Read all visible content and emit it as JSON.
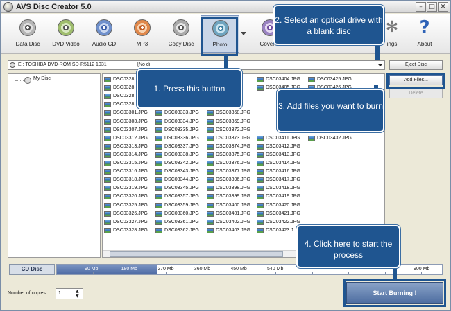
{
  "window": {
    "title": "AVS Disc Creator 5.0"
  },
  "toolbar": {
    "data_disc": "Data Disc",
    "dvd_video": "DVD Video",
    "audio_cd": "Audio CD",
    "mp3": "MP3",
    "copy_disc": "Copy Disc",
    "photo": "Photo",
    "cover": "Cover E",
    "settings": "ings",
    "about": "About"
  },
  "drive": {
    "value": "E : TOSHIBA  DVD-ROM SD-R5112 1031",
    "status": "[No di"
  },
  "buttons": {
    "eject": "Eject Disc",
    "add_files": "Add Files...",
    "delete": "Delete",
    "start": "Start Burning !"
  },
  "tree": {
    "root": "My Disc"
  },
  "files": {
    "col1": [
      "DSC0328",
      "DSC0328",
      "DSC0328",
      "DSC0328",
      "DSC03301.JPG",
      "DSC03303.JPG",
      "DSC03307.JPG",
      "DSC03312.JPG",
      "DSC03313.JPG",
      "DSC03314.JPG",
      "DSC03315.JPG",
      "DSC03316.JPG",
      "DSC03318.JPG",
      "DSC03319.JPG",
      "DSC03320.JPG",
      "DSC03325.JPG",
      "DSC03326.JPG",
      "DSC03327.JPG",
      "DSC03328.JPG"
    ],
    "col2": [
      "",
      "",
      "",
      "",
      "DSC03333.JPG",
      "DSC03334.JPG",
      "DSC03335.JPG",
      "DSC03336.JPG",
      "DSC03337.JPG",
      "DSC03338.JPG",
      "DSC03342.JPG",
      "DSC03343.JPG",
      "DSC03344.JPG",
      "DSC03345.JPG",
      "DSC03357.JPG",
      "DSC03359.JPG",
      "DSC03360.JPG",
      "DSC03361.JPG",
      "DSC03362.JPG"
    ],
    "col3": [
      "JPG",
      "JPG",
      "JPG",
      "JPG",
      "DSC03368.JPG",
      "DSC03369.JPG",
      "DSC03372.JPG",
      "DSC03373.JPG",
      "DSC03374.JPG",
      "DSC03375.JPG",
      "DSC03376.JPG",
      "DSC03377.JPG",
      "DSC03396.JPG",
      "DSC03398.JPG",
      "DSC03399.JPG",
      "DSC03400.JPG",
      "DSC03401.JPG",
      "DSC03402.JPG",
      "DSC03403.JPG"
    ],
    "col4": [
      "DSC03404.JPG",
      "DSC03405.JPG",
      "",
      "",
      "",
      "",
      "",
      "DSC03411.JPG",
      "DSC03412.JPG",
      "DSC03413.JPG",
      "DSC03414.JPG",
      "DSC03416.JPG",
      "DSC03417.JPG",
      "DSC03418.JPG",
      "DSC03419.JPG",
      "DSC03420.JPG",
      "DSC03421.JPG",
      "DSC03422.JPG",
      "DSC03423.J"
    ],
    "col5": [
      "DSC03425.JPG",
      "DSC03426.JPG",
      "",
      "",
      "",
      "",
      "",
      "DSC03432.JPG"
    ]
  },
  "capacity": {
    "disc_type": "CD Disc",
    "used_fraction": 0.26,
    "ticks": [
      "90 Mb",
      "180 Mb",
      "270 Mb",
      "360 Mb",
      "450 Mb",
      "540 Mb",
      "",
      "",
      "",
      "900 Mb"
    ]
  },
  "copies": {
    "label": "Number of copies:",
    "value": "1"
  },
  "callouts": {
    "c1": "1. Press this button",
    "c2": "2. Select an optical drive with a blank disc",
    "c3": "3. Add files you want to burn",
    "c4": "4. Click here to start the process"
  },
  "colors": {
    "callout": "#1f5590",
    "capacity_fill": "#4d6aa4"
  }
}
